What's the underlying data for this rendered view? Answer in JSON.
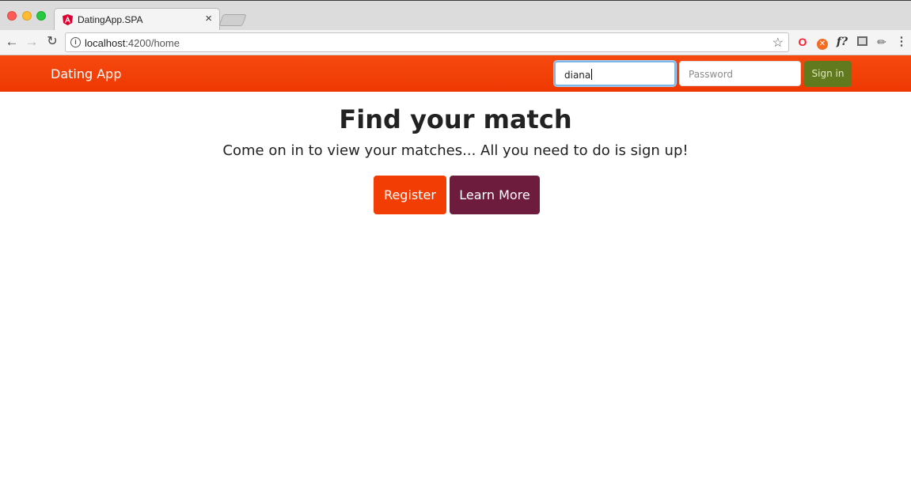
{
  "browser": {
    "tab_title": "DatingApp.SPA",
    "tab_close": "×",
    "url_host": "localhost",
    "url_rest": ":4200/home",
    "icons": {
      "back": "arrow-left-icon",
      "forward": "arrow-right-icon",
      "reload": "reload-icon",
      "info": "info-icon",
      "bookmark": "star-icon",
      "extensions": [
        "opera-icon",
        "orange-extension-icon",
        "function-extension-icon",
        "pocket-icon",
        "eyedropper-icon",
        "menu-icon"
      ]
    }
  },
  "navbar": {
    "brand": "Dating App",
    "username_value": "diana",
    "password_placeholder": "Password",
    "signin_label": "Sign in"
  },
  "hero": {
    "title": "Find your match",
    "subtitle": "Come on in to view your matches... All you need to do is sign up!",
    "register_label": "Register",
    "learn_more_label": "Learn More"
  },
  "colors": {
    "primary": "#f23d05",
    "success": "#627a1e",
    "secondary": "#6e1c3e"
  }
}
